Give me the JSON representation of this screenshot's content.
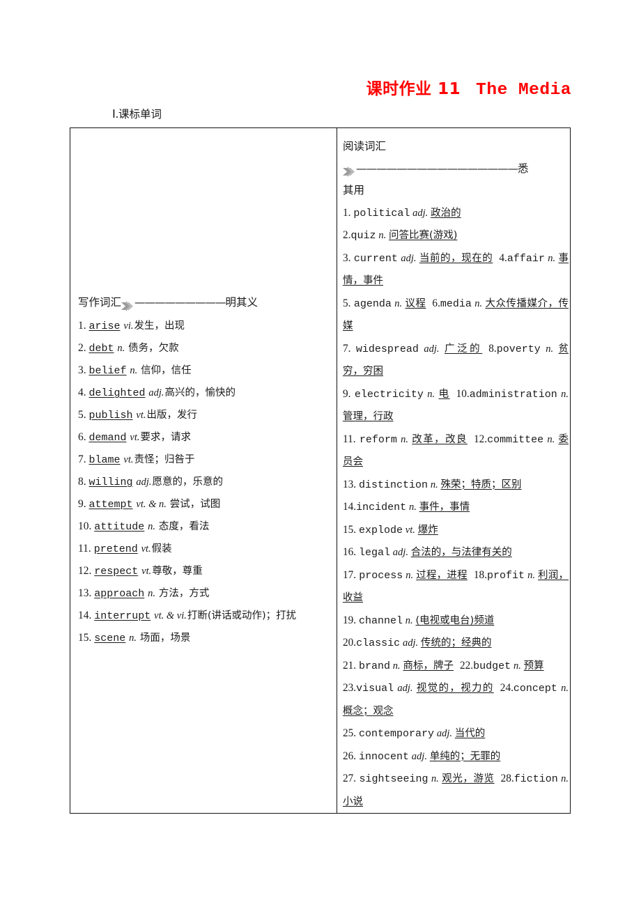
{
  "title": {
    "cn": "课时作业 11",
    "en": "The Media",
    "color": "#ff0000"
  },
  "section_heading": {
    "numeral": "Ⅰ",
    "dot": ".",
    "label": "课标单词"
  },
  "left_column": {
    "lead": {
      "label": "写作词汇",
      "arrow_icon": "double-chevron-right-icon",
      "dashes": "—————————",
      "tail": "明其义"
    },
    "items": [
      {
        "num": "1.",
        "word": "arise",
        "pos": "vi.",
        "def": "发生，出现"
      },
      {
        "num": "2.",
        "word": "debt",
        "pos": "n.",
        "def": "债务，欠款"
      },
      {
        "num": "3.",
        "word": "belief",
        "pos": "n.",
        "def": "信仰，信任"
      },
      {
        "num": "4.",
        "word": "delighted",
        "pos": "adj.",
        "def": "高兴的，愉快的"
      },
      {
        "num": "5.",
        "word": "publish",
        "pos": "vt.",
        "def": "出版，发行"
      },
      {
        "num": "6.",
        "word": "demand",
        "pos": "vt.",
        "def": "要求，请求"
      },
      {
        "num": "7.",
        "word": "blame",
        "pos": "vt.",
        "def": "责怪；归咎于"
      },
      {
        "num": "8.",
        "word": "willing",
        "pos": "adj.",
        "def": "愿意的，乐意的"
      },
      {
        "num": "9.",
        "word": "attempt",
        "pos": "vt. & n.",
        "def": "尝试，试图"
      },
      {
        "num": "10.",
        "word": "attitude",
        "pos": "n.",
        "def": "态度，看法"
      },
      {
        "num": "11.",
        "word": "pretend",
        "pos": "vt.",
        "def": "假装"
      },
      {
        "num": "12.",
        "word": "respect",
        "pos": "vt.",
        "def": "尊敬，尊重"
      },
      {
        "num": "13.",
        "word": "approach",
        "pos": "n.",
        "def": "方法，方式"
      },
      {
        "num": "14.",
        "word": "interrupt",
        "pos": "vt. & vi.",
        "def": "打断(讲话或动作)；打扰"
      },
      {
        "num": "15.",
        "word": "scene",
        "pos": "n.",
        "def": "场面，场景"
      }
    ]
  },
  "right_column": {
    "lead": {
      "label": "阅读词汇",
      "arrow_icon": "double-chevron-right-icon",
      "dashes": "————————————————",
      "tail": "悉",
      "tail2": "其用"
    },
    "items": [
      {
        "num": "1.",
        "word": "political",
        "pos": "adj.",
        "def": "政治的"
      },
      {
        "num": "2.",
        "word": "quiz",
        "pos": "n.",
        "def": "问答比赛(游戏)"
      },
      {
        "num": "3.",
        "word": "current",
        "pos": "adj.",
        "def": "当前的，现在的"
      },
      {
        "num": "4.",
        "word": "affair",
        "pos": "n.",
        "def": "事情，事件"
      },
      {
        "num": "5.",
        "word": "agenda",
        "pos": "n.",
        "def": "议程"
      },
      {
        "num": "6.",
        "word": "media",
        "pos": "n.",
        "def": "大众传播媒介，传媒"
      },
      {
        "num": "7.",
        "word": "widespread",
        "pos": "adj.",
        "def": "广泛的"
      },
      {
        "num": "8.",
        "word": "poverty",
        "pos": "n.",
        "def": "贫穷，穷困"
      },
      {
        "num": "9.",
        "word": "electricity",
        "pos": "n.",
        "def": "电"
      },
      {
        "num": "10.",
        "word": "administration",
        "pos": "n.",
        "def": "管理，行政"
      },
      {
        "num": "11.",
        "word": "reform",
        "pos": "n.",
        "def": "改革，改良"
      },
      {
        "num": "12.",
        "word": "committee",
        "pos": "n.",
        "def": "委员会"
      },
      {
        "num": "13.",
        "word": "distinction",
        "pos": "n.",
        "def": "殊荣；特质；区别"
      },
      {
        "num": "14.",
        "word": "incident",
        "pos": "n.",
        "def": "事件，事情"
      },
      {
        "num": "15.",
        "word": "explode",
        "pos": "vt.",
        "def": "爆炸"
      },
      {
        "num": "16.",
        "word": "legal",
        "pos": "adj.",
        "def": "合法的，与法律有关的"
      },
      {
        "num": "17.",
        "word": "process",
        "pos": "n.",
        "def": "过程，进程"
      },
      {
        "num": "18.",
        "word": "profit",
        "pos": "n.",
        "def": "利润，收益"
      },
      {
        "num": "19.",
        "word": "channel",
        "pos": "n.",
        "def": "(电视或电台)频道"
      },
      {
        "num": "20.",
        "word": "classic",
        "pos": "adj.",
        "def": "传统的；经典的"
      },
      {
        "num": "21.",
        "word": "brand",
        "pos": "n.",
        "def": "商标，牌子"
      },
      {
        "num": "22.",
        "word": "budget",
        "pos": "n.",
        "def": "预算"
      },
      {
        "num": "23.",
        "word": "visual",
        "pos": "adj.",
        "def": "视觉的，视力的"
      },
      {
        "num": "24.",
        "word": "concept",
        "pos": "n.",
        "def": "概念；观念"
      },
      {
        "num": "25.",
        "word": "contemporary",
        "pos": "adj.",
        "def": "当代的"
      },
      {
        "num": "26.",
        "word": "innocent",
        "pos": "adj.",
        "def": "单纯的；无罪的"
      },
      {
        "num": "27.",
        "word": "sightseeing",
        "pos": "n.",
        "def": "观光，游览"
      },
      {
        "num": "28.",
        "word": "fiction",
        "pos": "n.",
        "def": "小说"
      }
    ]
  }
}
